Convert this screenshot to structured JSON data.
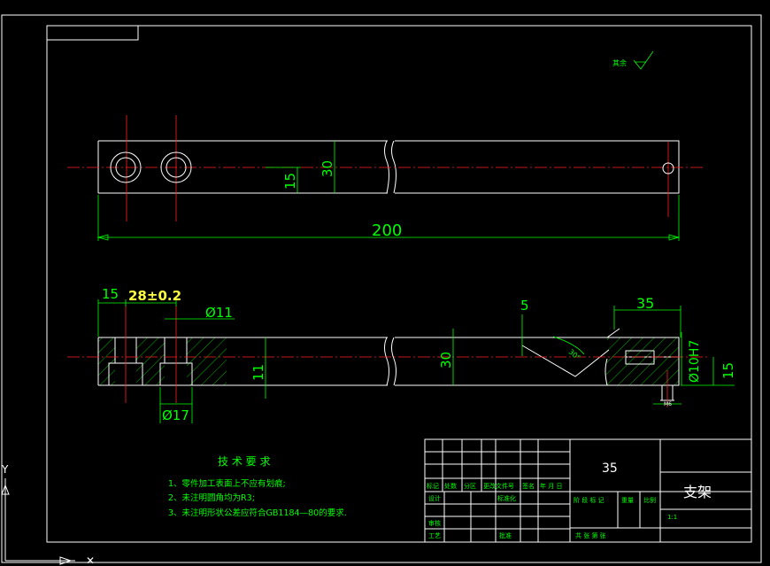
{
  "dimensions": {
    "length": "200",
    "height_top": "30",
    "offset_top": "15",
    "dim_15": "15",
    "dim_28": "28±0.2",
    "dia_11": "Ø11",
    "dia_17": "Ø17",
    "depth_5": "5",
    "dim_35": "35",
    "height_front": "30",
    "depth_11": "11",
    "dia_10h7": "Ø10H7",
    "offset_15_right": "15",
    "angle": "30°",
    "thread": "M6"
  },
  "roughness_symbol": "其余",
  "tech_requirements": {
    "title": "技 术 要 求",
    "items": [
      "1、零件加工表面上不应有划痕;",
      "2、未注明圆角均为R3;",
      "3、未注明形状公差应符合GB1184—80的要求."
    ]
  },
  "title_block": {
    "material": "35",
    "part_name": "支架",
    "scale": "1:1",
    "row_labels": [
      "标记",
      "处数",
      "分区",
      "更改文件号",
      "签名",
      "年 月 日"
    ],
    "design": "设计",
    "standardize": "标准化",
    "check": "审核",
    "process": "工艺",
    "approve": "批准",
    "stage_label": "阶 段 标 记",
    "weight_label": "重量",
    "scale_label": "比例",
    "sheet_label": "共     张     第     张"
  },
  "ucs": {
    "y": "Y"
  }
}
